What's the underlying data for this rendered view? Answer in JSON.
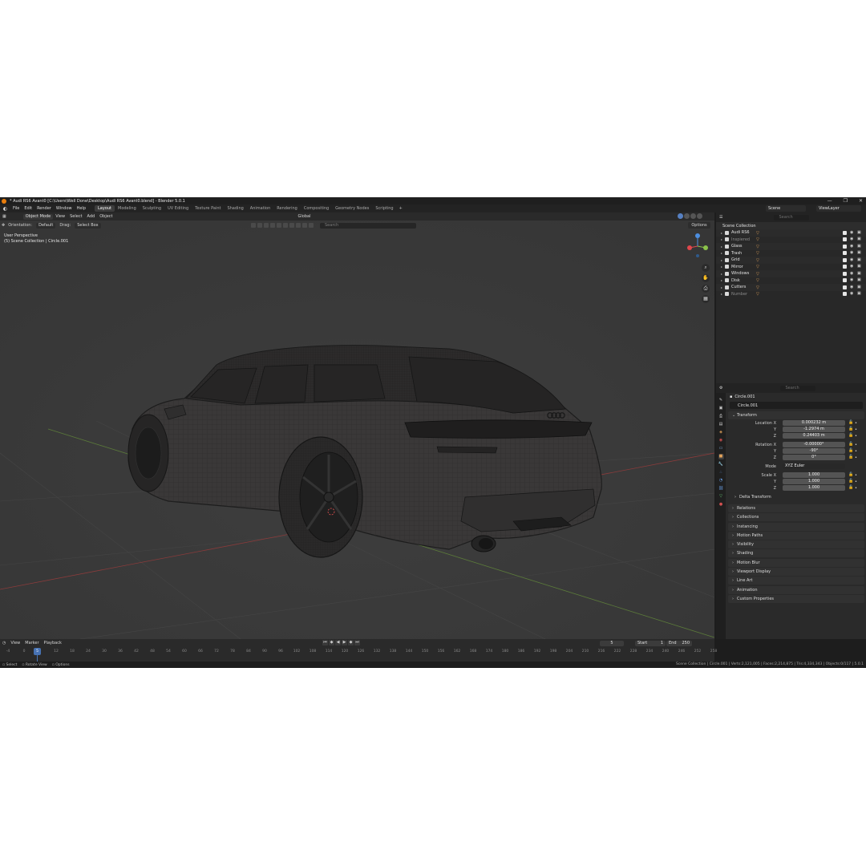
{
  "window": {
    "title": "* Audi RS6 Avant0 [C:\\Users\\Well Done\\Desktop\\Audi RS6 Avant0.blend] - Blender 5.0.1",
    "controls": [
      "—",
      "❐",
      "✕"
    ]
  },
  "menu": {
    "items": [
      "File",
      "Edit",
      "Render",
      "Window",
      "Help"
    ],
    "workspaces": [
      "Layout",
      "Modeling",
      "Sculpting",
      "UV Editing",
      "Texture Paint",
      "Shading",
      "Animation",
      "Rendering",
      "Compositing",
      "Geometry Nodes",
      "Scripting"
    ],
    "active_workspace": "Layout",
    "add_tab": "+",
    "scene": "Scene",
    "view_layer": "ViewLayer"
  },
  "viewport": {
    "mode": "Object Mode",
    "menus": [
      "View",
      "Select",
      "Add",
      "Object"
    ],
    "orientation_label": "Orientation:",
    "orientation_value": "Default",
    "drag_label": "Drag:",
    "drag_value": "Select Box",
    "transform_space": "Global",
    "search_placeholder": "Search",
    "options_label": "Options",
    "info_line1": "User Perspective",
    "info_line2": "(5) Scene Collection | Circle.001",
    "gizmo": {
      "x_color": "#e0474c",
      "y_color": "#8bc34a",
      "z_color": "#4c8ee0"
    }
  },
  "timeline": {
    "menus": [
      "View",
      "Marker",
      "Playback"
    ],
    "current_frame": "5",
    "start_label": "Start",
    "start_value": "1",
    "end_label": "End",
    "end_value": "250",
    "ticks": [
      "-4",
      "0",
      "5",
      "12",
      "18",
      "24",
      "30",
      "36",
      "42",
      "48",
      "54",
      "60",
      "66",
      "72",
      "78",
      "84",
      "90",
      "96",
      "102",
      "108",
      "114",
      "120",
      "126",
      "132",
      "138",
      "144",
      "150",
      "156",
      "162",
      "168",
      "174",
      "180",
      "186",
      "192",
      "198",
      "204",
      "210",
      "216",
      "222",
      "228",
      "234",
      "240",
      "246",
      "252",
      "258"
    ]
  },
  "statusbar": {
    "select": "Select",
    "rotate": "Rotate View",
    "options": "Options",
    "stats": "Scene Collection | Circle.001 | Verts:2,121,005 | Faces:2,214,875 | Tris:4,334,343 | Objects:0/117 | 5.0.1"
  },
  "outliner": {
    "search_placeholder": "Search",
    "root": "Scene Collection",
    "rows": [
      {
        "label": "Audi RS6",
        "dim": false
      },
      {
        "label": "Inspiered",
        "dim": true
      },
      {
        "label": "Glass",
        "dim": false
      },
      {
        "label": "Trash",
        "dim": false
      },
      {
        "label": "Grid",
        "dim": false
      },
      {
        "label": "Mirror",
        "dim": false
      },
      {
        "label": "Windows",
        "dim": false
      },
      {
        "label": "Disk",
        "dim": false
      },
      {
        "label": "Cutters",
        "dim": false
      },
      {
        "label": "Number",
        "dim": true
      }
    ]
  },
  "properties": {
    "search_placeholder": "Search",
    "object_name": "Circle.001",
    "data_name": "Circle.001",
    "transform_label": "Transform",
    "location": {
      "label_x": "Location X",
      "x": "0.000232 m",
      "y": "-1.2974 m",
      "z": "0.24403 m"
    },
    "rotation": {
      "label_x": "Rotation X",
      "x": "-0.00000°",
      "y": "-90°",
      "z": "0°"
    },
    "mode_label": "Mode",
    "mode_value": "XYZ Euler",
    "scale": {
      "label_x": "Scale X",
      "x": "1.000",
      "y": "1.000",
      "z": "1.000"
    },
    "axis_y": "Y",
    "axis_z": "Z",
    "delta_transform": "Delta Transform",
    "panels": [
      "Relations",
      "Collections",
      "Instancing",
      "Motion Paths",
      "Visibility",
      "Shading",
      "Motion Blur",
      "Viewport Display",
      "Line Art",
      "Animation",
      "Custom Properties"
    ]
  }
}
